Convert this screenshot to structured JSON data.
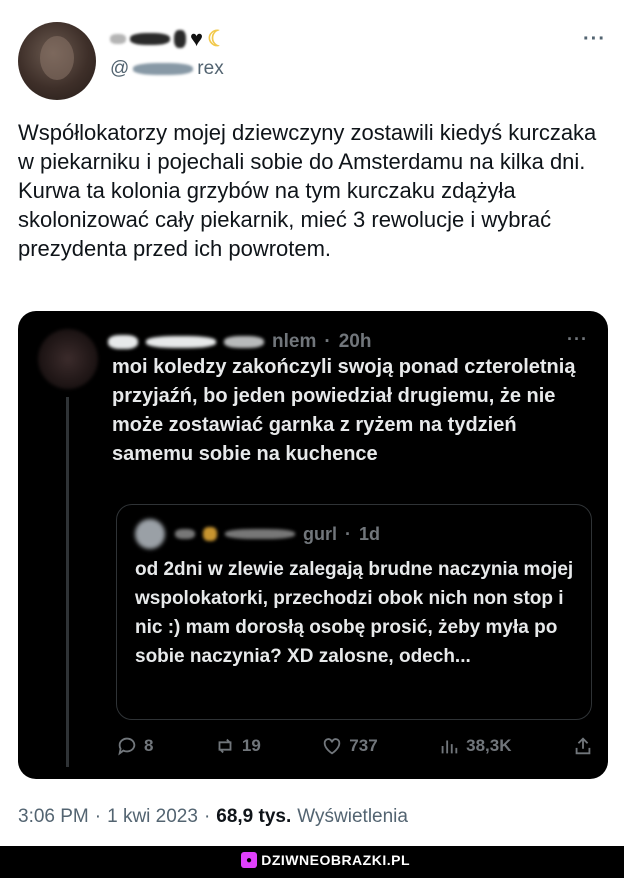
{
  "outer_tweet": {
    "handle_prefix": "@",
    "handle_suffix": "rex",
    "more_label": "···",
    "text": "Współlokatorzy mojej dziewczyny zostawili kiedyś kurczaka w piekarniku i pojechali sobie do Amsterdamu na kilka dni. Kurwa ta kolonia grzybów na tym kurczaku zdążyła skolonizować cały piekarnik, mieć 3 rewolucje i wybrać prezydenta przed ich powrotem.",
    "time": "3:06 PM",
    "date": "1 kwi 2023",
    "views_count": "68,9 tys.",
    "views_label": "Wyświetlenia"
  },
  "inner_tweet": {
    "handle_tail": "nlem",
    "age": "20h",
    "more_label": "···",
    "text": "moi koledzy zakończyli swoją ponad czteroletnią przyjaźń, bo jeden powiedział drugiemu, że nie może zostawiać garnka z ryżem na tydzień samemu sobie na kuchence",
    "quoted": {
      "handle_tail": "gurl",
      "age": "1d",
      "text": "od 2dni w zlewie zalegają brudne naczynia mojej wspolokatorki, przechodzi obok nich non stop i nic :) mam dorosłą osobę prosić, żeby myła po sobie naczynia? XD zalosne, odech..."
    },
    "actions": {
      "replies": "8",
      "retweets": "19",
      "likes": "737",
      "views": "38,3K"
    }
  },
  "watermark": {
    "text": "DZIWNEOBRAZKI.PL"
  },
  "colors": {
    "dark_bg": "#000000",
    "dark_text": "#e7e9ea",
    "muted": "#71767b",
    "light_muted": "#536471"
  }
}
